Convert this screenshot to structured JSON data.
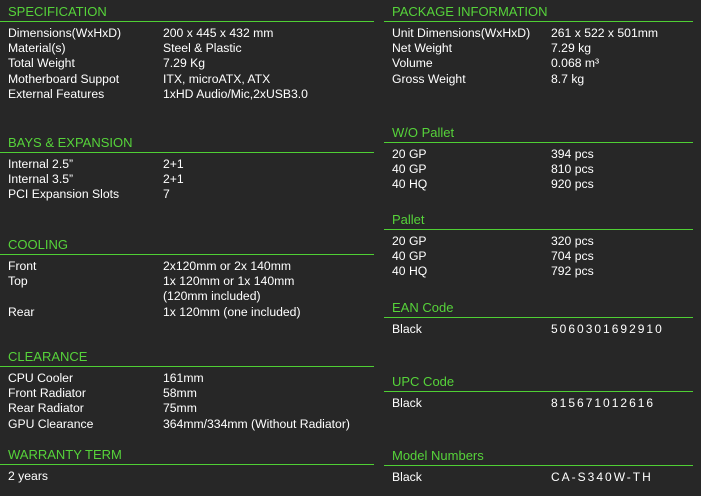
{
  "left": {
    "specification": {
      "title": "SPECIFICATION",
      "rows": [
        {
          "k": "Dimensions(WxHxD)",
          "v": [
            "200 x 445 x 432 mm"
          ]
        },
        {
          "k": "Material(s)",
          "v": [
            "Steel & Plastic"
          ]
        },
        {
          "k": "Total Weight",
          "v": [
            "7.29 Kg"
          ]
        },
        {
          "k": "Motherboard Suppot",
          "v": [
            "ITX, microATX, ATX"
          ]
        },
        {
          "k": "External Features",
          "v": [
            "1xHD Audio/Mic,2xUSB3.0"
          ]
        }
      ]
    },
    "bays": {
      "title": "BAYS & EXPANSION",
      "rows": [
        {
          "k": "Internal 2.5”",
          "v": [
            "2+1"
          ]
        },
        {
          "k": "Internal 3.5”",
          "v": [
            "2+1"
          ]
        },
        {
          "k": "PCI Expansion Slots",
          "v": [
            "7"
          ]
        }
      ]
    },
    "cooling": {
      "title": "COOLING",
      "rows": [
        {
          "k": "Front",
          "v": [
            "2x120mm or 2x 140mm"
          ]
        },
        {
          "k": "Top",
          "v": [
            "1x 120mm or 1x 140mm",
            "(120mm included)"
          ]
        },
        {
          "k": "Rear",
          "v": [
            "1x 120mm (one included)"
          ]
        }
      ]
    },
    "clearance": {
      "title": "CLEARANCE",
      "rows": [
        {
          "k": "CPU Cooler",
          "v": [
            "161mm"
          ]
        },
        {
          "k": "Front Radiator",
          "v": [
            "58mm"
          ]
        },
        {
          "k": "Rear Radiator",
          "v": [
            "75mm"
          ]
        },
        {
          "k": "GPU Clearance",
          "v": [
            "364mm/334mm (Without Radiator)"
          ]
        }
      ]
    },
    "warranty": {
      "title": "WARRANTY TERM",
      "rows": [
        {
          "k": "2 years",
          "v": [
            ""
          ]
        }
      ]
    }
  },
  "right": {
    "package": {
      "title": "PACKAGE INFORMATION",
      "rows": [
        {
          "k": "Unit Dimensions(WxHxD)",
          "v": [
            "261 x 522 x 501mm"
          ]
        },
        {
          "k": "Net Weight",
          "v": [
            "7.29 kg"
          ]
        },
        {
          "k": "Volume",
          "v": [
            "0.068 m³"
          ]
        },
        {
          "k": "Gross Weight",
          "v": [
            "8.7 kg"
          ]
        }
      ]
    },
    "wo_pallet": {
      "title": "W/O Pallet",
      "rows": [
        {
          "k": "20 GP",
          "v": [
            "394 pcs"
          ]
        },
        {
          "k": "40 GP",
          "v": [
            "810 pcs"
          ]
        },
        {
          "k": "40 HQ",
          "v": [
            "920 pcs"
          ]
        }
      ]
    },
    "pallet": {
      "title": "Pallet",
      "rows": [
        {
          "k": "20 GP",
          "v": [
            "320 pcs"
          ]
        },
        {
          "k": "40 GP",
          "v": [
            "704 pcs"
          ]
        },
        {
          "k": "40 HQ",
          "v": [
            "792 pcs"
          ]
        }
      ]
    },
    "ean": {
      "title": "EAN Code",
      "rows": [
        {
          "k": "Black",
          "v": [
            "5060301692910"
          ],
          "mono": true
        }
      ]
    },
    "upc": {
      "title": "UPC Code",
      "rows": [
        {
          "k": "Black",
          "v": [
            "815671012616"
          ],
          "mono": true
        }
      ]
    },
    "model": {
      "title": "Model Numbers",
      "rows": [
        {
          "k": "Black",
          "v": [
            "CA-S340W-TH"
          ],
          "mono": true
        }
      ]
    }
  },
  "colors": {
    "accent": "#56d33a",
    "background": "#272727",
    "text": "#ffffff"
  }
}
